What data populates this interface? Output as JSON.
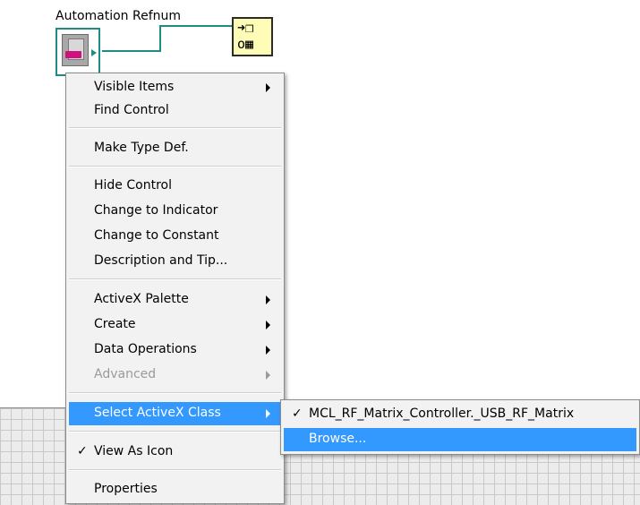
{
  "control": {
    "label": "Automation Refnum"
  },
  "node": {
    "glyph_top": "➜❒",
    "glyph_bottom": "o▦"
  },
  "context_menu": {
    "items": [
      {
        "label": "Visible Items",
        "submenu": true
      },
      {
        "label": "Find Control"
      },
      {
        "label": "Make Type Def."
      },
      {
        "label": "Hide Control"
      },
      {
        "label": "Change to Indicator"
      },
      {
        "label": "Change to Constant"
      },
      {
        "label": "Description and Tip..."
      },
      {
        "label": "ActiveX Palette",
        "submenu": true
      },
      {
        "label": "Create",
        "submenu": true
      },
      {
        "label": "Data Operations",
        "submenu": true
      },
      {
        "label": "Advanced",
        "submenu": true,
        "disabled": true
      },
      {
        "label": "Select ActiveX Class",
        "submenu": true,
        "highlighted": true
      },
      {
        "label": "View As Icon",
        "checked": true
      },
      {
        "label": "Properties"
      }
    ],
    "check_glyph": "✓"
  },
  "submenu": {
    "items": [
      {
        "label": "MCL_RF_Matrix_Controller._USB_RF_Matrix",
        "checked": true
      },
      {
        "label": "Browse...",
        "highlighted": true
      }
    ]
  },
  "colors": {
    "wire": "#1e8c85",
    "highlight": "#3399ff",
    "node_fill": "#fffcb8"
  }
}
